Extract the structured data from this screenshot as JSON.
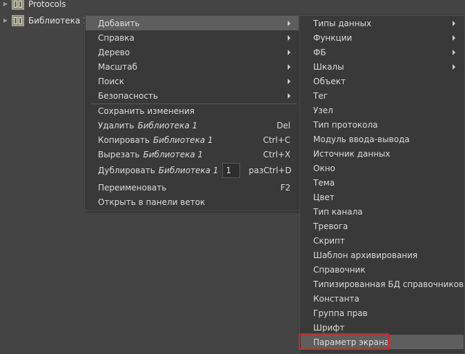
{
  "tree": {
    "items": [
      {
        "label": "Protocols",
        "icon": "library-icon"
      },
      {
        "label": "Библиотека 1",
        "icon": "library-icon"
      }
    ]
  },
  "context_menu": {
    "items": [
      {
        "label": "Добавить",
        "submenu": true
      },
      {
        "label": "Справка",
        "submenu": true
      },
      {
        "label": "Дерево",
        "submenu": true
      },
      {
        "label": "Масштаб",
        "submenu": true
      },
      {
        "label": "Поиск",
        "submenu": true
      },
      {
        "label": "Безопасность",
        "submenu": true
      },
      {
        "label": "Сохранить изменения"
      },
      {
        "label": "Удалить",
        "target": "Библиотека 1",
        "shortcut": "Del"
      },
      {
        "label": "Копировать",
        "target": "Библиотека 1",
        "shortcut": "Ctrl+C"
      },
      {
        "label": "Вырезать",
        "target": "Библиотека 1",
        "shortcut": "Ctrl+X"
      },
      {
        "label": "Дублировать",
        "target": "Библиотека 1",
        "count": "1",
        "unit": "раз",
        "shortcut": "Ctrl+D"
      },
      {
        "label": "Переименовать",
        "shortcut": "F2"
      },
      {
        "label": "Открыть в панели веток"
      }
    ]
  },
  "add_submenu": {
    "items": [
      {
        "label": "Типы данных",
        "submenu": true
      },
      {
        "label": "Функции",
        "submenu": true
      },
      {
        "label": "ФБ",
        "submenu": true
      },
      {
        "label": "Шкалы",
        "submenu": true
      },
      {
        "label": "Объект"
      },
      {
        "label": "Тег"
      },
      {
        "label": "Узел"
      },
      {
        "label": "Тип протокола"
      },
      {
        "label": "Модуль ввода-вывода"
      },
      {
        "label": "Источник данных"
      },
      {
        "label": "Окно"
      },
      {
        "label": "Тема"
      },
      {
        "label": "Цвет"
      },
      {
        "label": "Тип канала"
      },
      {
        "label": "Тревога"
      },
      {
        "label": "Скрипт"
      },
      {
        "label": "Шаблон архивирования"
      },
      {
        "label": "Справочник"
      },
      {
        "label": "Типизированная БД справочников"
      },
      {
        "label": "Константа"
      },
      {
        "label": "Группа прав"
      },
      {
        "label": "Шрифт"
      },
      {
        "label": "Параметр экрана"
      }
    ]
  },
  "colors": {
    "background": "#444444",
    "menu_background": "#393939",
    "hover": "#5e5e5e",
    "annotation_box": "#d8232a"
  }
}
